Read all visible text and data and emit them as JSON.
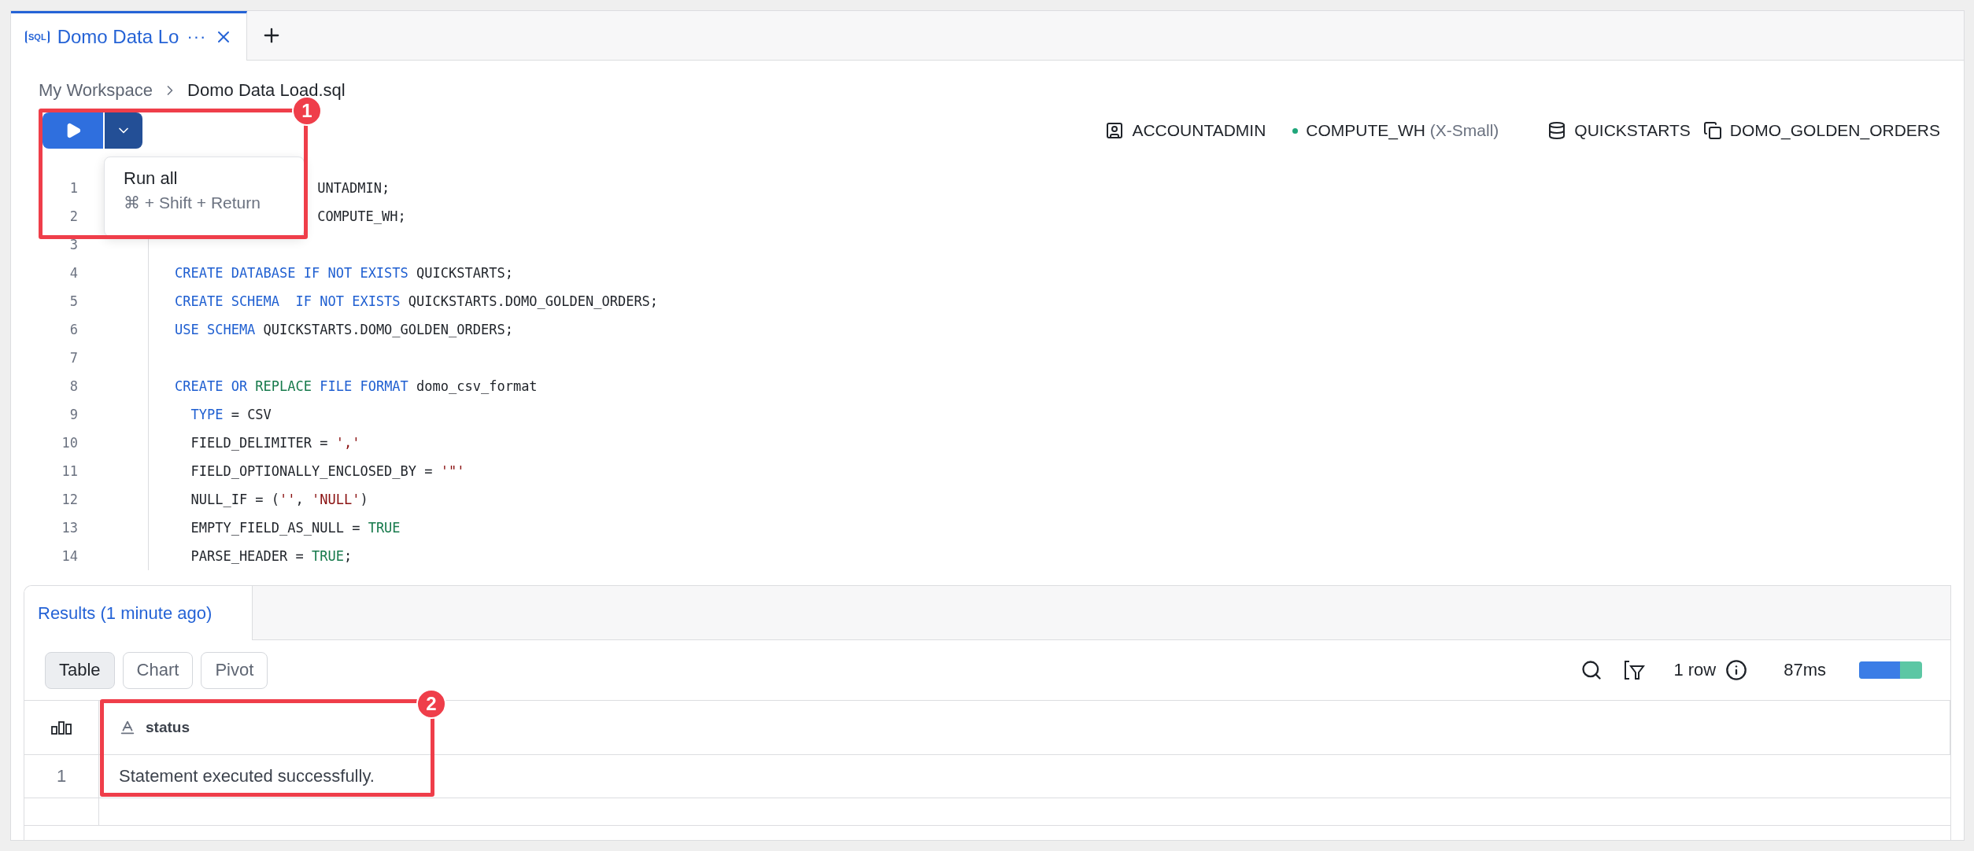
{
  "tabs": [
    {
      "badge": "SQL",
      "title": "Domo Data Lo",
      "overflow_mark": "···",
      "selected": true
    }
  ],
  "breadcrumb": [
    "My Workspace",
    "Domo Data Load.sql"
  ],
  "run_menu": {
    "items": [
      {
        "label": "Run all",
        "shortcut": "⌘ + Shift + Return"
      }
    ]
  },
  "context": {
    "role": "ACCOUNTADMIN",
    "warehouse": "COMPUTE_WH",
    "warehouse_size": "(X-Small)",
    "database": "QUICKSTARTS",
    "schema": "DOMO_GOLDEN_ORDERS"
  },
  "code_lines": [
    {
      "number": "1",
      "kind": "partial",
      "tokens": [
        {
          "t": "UNTADMIN;",
          "kind": "plain"
        }
      ]
    },
    {
      "number": "2",
      "kind": "partial",
      "tokens": [
        {
          "t": "COMPUTE_WH;",
          "kind": "plain"
        }
      ]
    },
    {
      "number": "3"
    },
    {
      "number": "4",
      "kind": "full",
      "tokens": [
        {
          "t": "CREATE DATABASE IF NOT EXISTS",
          "kind": "keyword"
        },
        {
          "t": " QUICKSTARTS;",
          "kind": "plain"
        }
      ]
    },
    {
      "number": "5",
      "kind": "full",
      "tokens": [
        {
          "t": "CREATE SCHEMA  IF NOT EXISTS",
          "kind": "keyword"
        },
        {
          "t": " QUICKSTARTS.DOMO_GOLDEN_ORDERS;",
          "kind": "plain"
        }
      ]
    },
    {
      "number": "6",
      "kind": "full",
      "tokens": [
        {
          "t": "USE SCHEMA",
          "kind": "keyword"
        },
        {
          "t": " QUICKSTARTS.DOMO_GOLDEN_ORDERS;",
          "kind": "plain"
        }
      ]
    },
    {
      "number": "7"
    },
    {
      "number": "8",
      "kind": "full",
      "tokens": [
        {
          "t": "CREATE OR ",
          "kind": "keyword"
        },
        {
          "t": "REPLACE",
          "kind": "literal"
        },
        {
          "t": " FILE FORMAT",
          "kind": "keyword"
        },
        {
          "t": " domo_csv_format",
          "kind": "plain"
        }
      ]
    },
    {
      "number": "9",
      "kind": "full",
      "tokens": [
        {
          "t": "  TYPE",
          "kind": "keyword"
        },
        {
          "t": " = CSV",
          "kind": "plain"
        }
      ]
    },
    {
      "number": "10",
      "kind": "full",
      "tokens": [
        {
          "t": "  FIELD_DELIMITER = ",
          "kind": "plain"
        },
        {
          "t": "','",
          "kind": "string"
        }
      ]
    },
    {
      "number": "11",
      "kind": "full",
      "tokens": [
        {
          "t": "  FIELD_OPTIONALLY_ENCLOSED_BY = ",
          "kind": "plain"
        },
        {
          "t": "'\"'",
          "kind": "string"
        }
      ]
    },
    {
      "number": "12",
      "kind": "full",
      "tokens": [
        {
          "t": "  NULL_IF = (",
          "kind": "plain"
        },
        {
          "t": "''",
          "kind": "string"
        },
        {
          "t": ", ",
          "kind": "plain"
        },
        {
          "t": "'NULL'",
          "kind": "string"
        },
        {
          "t": ")",
          "kind": "plain"
        }
      ]
    },
    {
      "number": "13",
      "kind": "full",
      "tokens": [
        {
          "t": "  EMPTY_FIELD_AS_NULL = ",
          "kind": "plain"
        },
        {
          "t": "TRUE",
          "kind": "literal"
        }
      ]
    },
    {
      "number": "14",
      "kind": "full",
      "tokens": [
        {
          "t": "  PARSE_HEADER = ",
          "kind": "plain"
        },
        {
          "t": "TRUE",
          "kind": "literal"
        },
        {
          "t": ";",
          "kind": "plain"
        }
      ]
    }
  ],
  "results": {
    "tab": "Results (1 minute ago)",
    "views": [
      {
        "label": "Table",
        "selected": true
      },
      {
        "label": "Chart",
        "selected": false
      },
      {
        "label": "Pivot",
        "selected": false
      }
    ],
    "row_count": "1 row",
    "duration": "87ms",
    "timing_bar": {
      "level": 0.65
    },
    "columns": [
      "status"
    ],
    "rows": [
      {
        "number": "1",
        "cells": [
          "Statement executed successfully."
        ]
      }
    ]
  },
  "annotations": [
    "1",
    "2"
  ]
}
